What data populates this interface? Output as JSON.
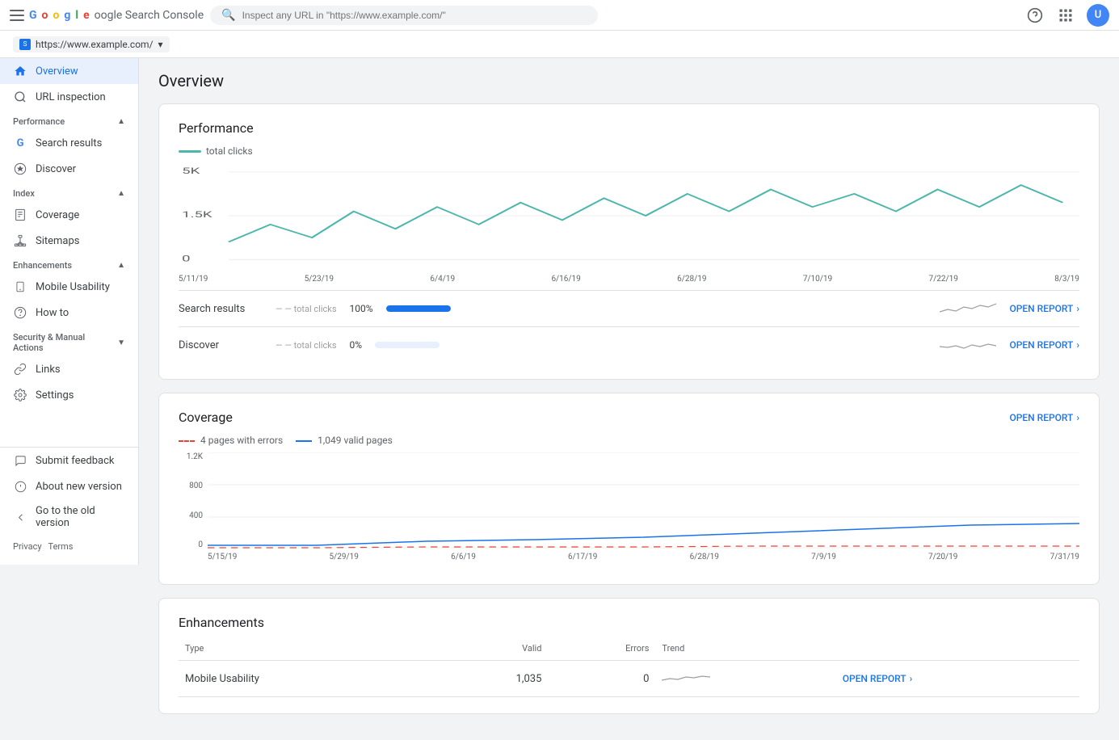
{
  "app": {
    "title": "Google Search Console",
    "logo_g": "G",
    "logo_rest": "oogle Search Console"
  },
  "topbar": {
    "search_placeholder": "Inspect any URL in \"https://www.example.com/\"",
    "help_icon": "?",
    "apps_icon": "⠿",
    "avatar_label": "U"
  },
  "property_bar": {
    "property_label": "https://www.example.com/",
    "property_icon": "S",
    "dropdown_icon": "▾"
  },
  "page_title": "Overview",
  "sidebar": {
    "items": [
      {
        "id": "overview",
        "label": "Overview",
        "icon": "home",
        "active": true
      },
      {
        "id": "url-inspection",
        "label": "URL inspection",
        "icon": "search"
      }
    ],
    "sections": [
      {
        "id": "performance",
        "label": "Performance",
        "collapsed": false,
        "items": [
          {
            "id": "search-results",
            "label": "Search results",
            "icon": "G"
          },
          {
            "id": "discover",
            "label": "Discover",
            "icon": "star"
          }
        ]
      },
      {
        "id": "index",
        "label": "Index",
        "collapsed": false,
        "items": [
          {
            "id": "coverage",
            "label": "Coverage",
            "icon": "doc"
          },
          {
            "id": "sitemaps",
            "label": "Sitemaps",
            "icon": "sitemap"
          }
        ]
      },
      {
        "id": "enhancements",
        "label": "Enhancements",
        "collapsed": false,
        "items": [
          {
            "id": "mobile-usability",
            "label": "Mobile Usability",
            "icon": "mobile"
          },
          {
            "id": "how-to",
            "label": "How to",
            "icon": "star2"
          }
        ]
      },
      {
        "id": "security",
        "label": "Security & Manual Actions",
        "collapsed": true,
        "items": []
      }
    ],
    "other": [
      {
        "id": "links",
        "label": "Links",
        "icon": "link"
      },
      {
        "id": "settings",
        "label": "Settings",
        "icon": "gear"
      }
    ],
    "footer": [
      {
        "id": "submit-feedback",
        "label": "Submit feedback"
      },
      {
        "id": "about-new",
        "label": "About new version"
      },
      {
        "id": "go-old",
        "label": "Go to the old version"
      }
    ],
    "privacy": "Privacy",
    "terms": "Terms"
  },
  "performance_card": {
    "title": "Performance",
    "legend_label": "total clicks",
    "legend_color": "#4db6ac",
    "chart_y_labels": [
      "5K",
      "1.5K",
      "0"
    ],
    "chart_x_labels": [
      "5/11/19",
      "5/23/19",
      "6/4/19",
      "6/16/19",
      "6/28/19",
      "7/10/19",
      "7/22/19",
      "8/3/19"
    ],
    "rows": [
      {
        "label": "Search results",
        "bar_text": "total clicks",
        "percent": "100%",
        "bar_fill": 100,
        "open_report": "OPEN REPORT"
      },
      {
        "label": "Discover",
        "bar_text": "total clicks",
        "percent": "0%",
        "bar_fill": 0,
        "open_report": "OPEN REPORT"
      }
    ]
  },
  "coverage_card": {
    "title": "Coverage",
    "open_report": "OPEN REPORT",
    "legend": [
      {
        "label": "4 pages with errors",
        "color": "#ea4335",
        "dashed": true
      },
      {
        "label": "1,049 valid pages",
        "color": "#1a73e8",
        "dashed": false
      }
    ],
    "y_labels": [
      "1.2K",
      "800",
      "400",
      "0"
    ],
    "x_labels": [
      "5/15/19",
      "5/29/19",
      "6/6/19",
      "6/17/19",
      "6/28/19",
      "7/9/19",
      "7/20/19",
      "7/31/19"
    ]
  },
  "enhancements_card": {
    "title": "Enhancements",
    "table_headers": [
      "Type",
      "Valid",
      "Errors",
      "Trend"
    ],
    "rows": [
      {
        "type": "Mobile Usability",
        "valid": "1,035",
        "errors": "0",
        "open_report": "OPEN REPORT"
      }
    ]
  }
}
